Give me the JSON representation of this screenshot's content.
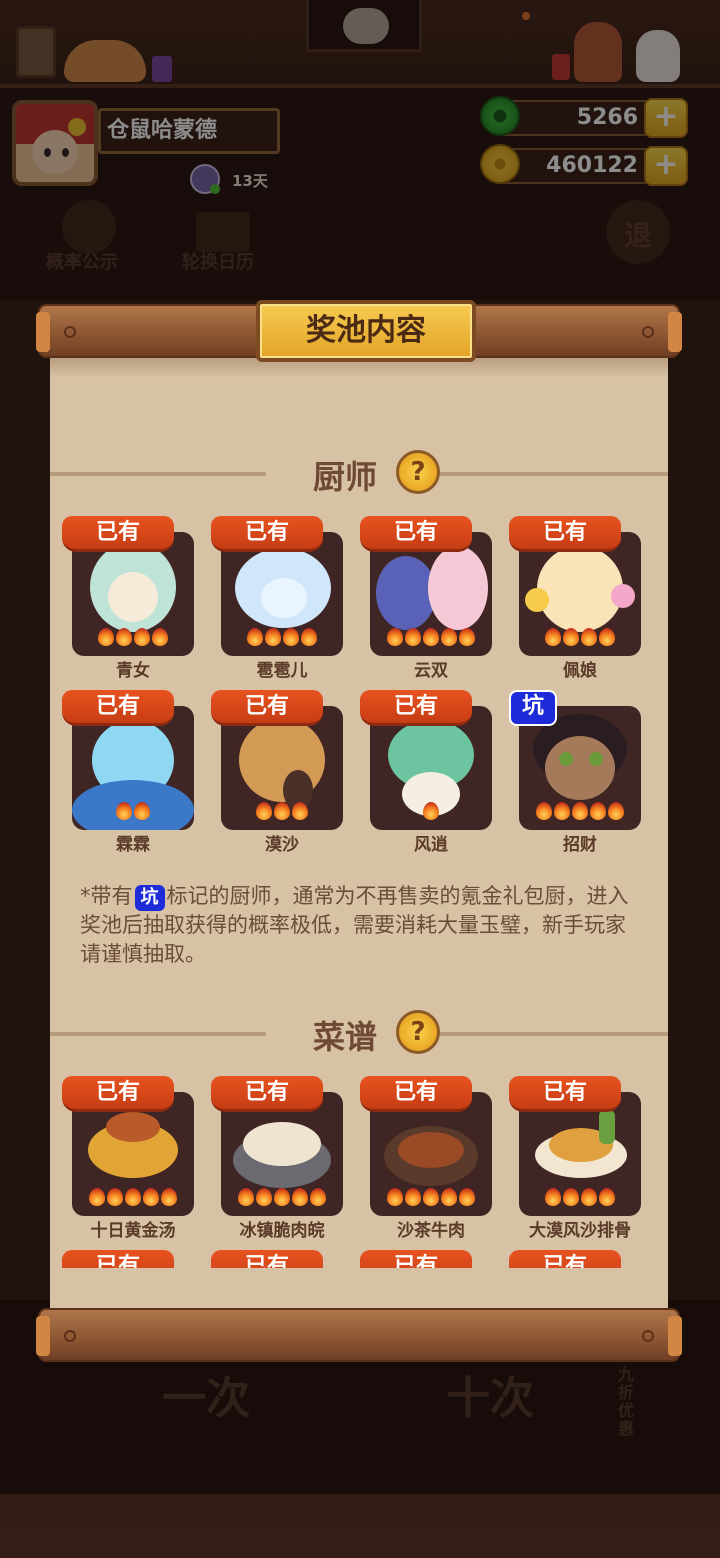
{
  "profile": {
    "name": "仓鼠哈蒙德",
    "days": "13天"
  },
  "currency": {
    "jade": "5266",
    "gold": "460122"
  },
  "background": {
    "btn_probability": "概率公示",
    "btn_calendar": "轮换日历",
    "btn_exit": "退",
    "btn_once": "一次",
    "btn_ten": "十次",
    "discount": "九折优惠"
  },
  "modal": {
    "title": "奖池内容",
    "chefs_section": "厨师",
    "recipes_section": "菜谱",
    "help": "?",
    "owned_label": "已有",
    "pit_label": "坑",
    "note_prefix": "*带有",
    "note_suffix": "标记的厨师，通常为不再售卖的氪金礼包厨，进入奖池后抽取获得的概率极低，需要消耗大量玉璧，新手玩家请谨慎抽取。",
    "chefs": [
      {
        "name": "青女",
        "status": "已有",
        "stars": 4
      },
      {
        "name": "雹雹儿",
        "status": "已有",
        "stars": 4
      },
      {
        "name": "云双",
        "status": "已有",
        "stars": 5
      },
      {
        "name": "佩娘",
        "status": "已有",
        "stars": 4
      },
      {
        "name": "霖霖",
        "status": "已有",
        "stars": 2
      },
      {
        "name": "漠沙",
        "status": "已有",
        "stars": 3
      },
      {
        "name": "风逍",
        "status": "已有",
        "stars": 1
      },
      {
        "name": "招财",
        "status": "坑",
        "stars": 5
      }
    ],
    "recipes": [
      {
        "name": "十日黄金汤",
        "status": "已有",
        "stars": 5
      },
      {
        "name": "冰镇脆肉皖",
        "status": "已有",
        "stars": 5
      },
      {
        "name": "沙茶牛肉",
        "status": "已有",
        "stars": 5
      },
      {
        "name": "大漠风沙排骨",
        "status": "已有",
        "stars": 4
      }
    ],
    "recipes_partial_row": [
      "已有",
      "已有",
      "已有",
      "已有"
    ]
  },
  "colors": {
    "badge_owned": "#d84a1a",
    "badge_pit": "#1d2bd9",
    "paper": "#d8c2a5",
    "title_gold": "#f0b83a"
  }
}
